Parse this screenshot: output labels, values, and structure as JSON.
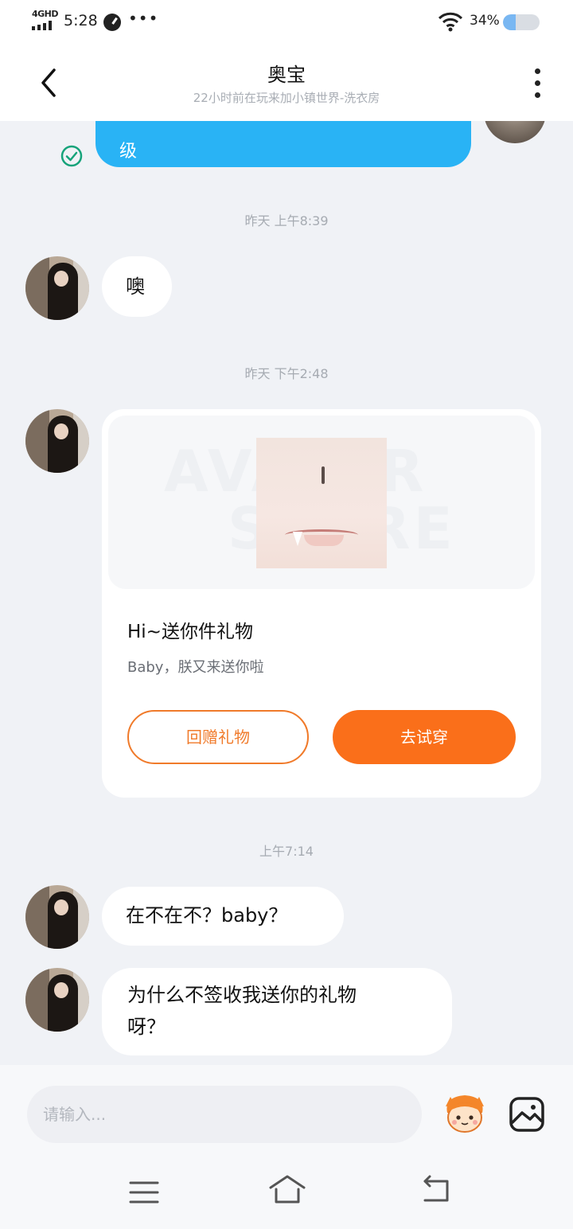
{
  "status_bar": {
    "network": "4GHD",
    "time": "5:28",
    "more": "•••",
    "battery_text": "34%",
    "battery_level": 0.34
  },
  "header": {
    "title": "奥宝",
    "subtitle": "22小时前在玩来加小镇世界-洗衣房"
  },
  "messages": {
    "sent_partial_text": "级",
    "timestamp_1": "昨天 上午8:39",
    "msg_1": "噢",
    "timestamp_2": "昨天 下午2:48",
    "gift_card": {
      "watermark_line1": "AVATAR",
      "watermark_line2": "STORE",
      "title": "Hi~送你件礼物",
      "description": "Baby，朕又来送你啦",
      "return_button": "回赠礼物",
      "try_button": "去试穿"
    },
    "timestamp_3": "上午7:14",
    "msg_2": "在不在不？baby？",
    "msg_3_line1": "为什么不签收我送你的礼物",
    "msg_3_line2": "呀？"
  },
  "input": {
    "placeholder": "请输入..."
  },
  "colors": {
    "sent_bubble": "#29b3f5",
    "accent_orange": "#fa6f1a",
    "background": "#f0f2f6",
    "read_check": "#16a37a"
  }
}
